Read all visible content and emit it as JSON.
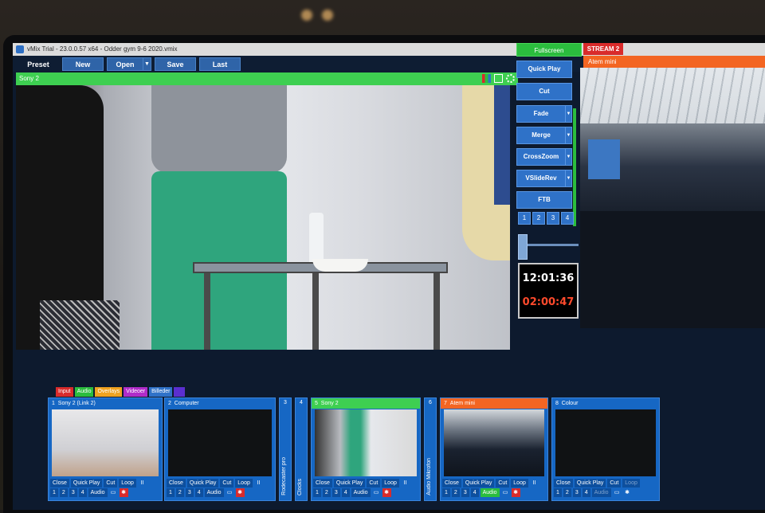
{
  "titlebar": {
    "text": "vMix Trial - 23.0.0.57 x64 - Odder gym 9-6 2020.vmix"
  },
  "toolbar": {
    "preset": "Preset",
    "new": "New",
    "open": "Open",
    "save": "Save",
    "last": "Last"
  },
  "preview": {
    "title": "Sony 2"
  },
  "fullscreen": "Fullscreen",
  "stream": "STREAM 2",
  "output": {
    "title": "Atem mini"
  },
  "transitions": {
    "quick_play": "Quick Play",
    "cut": "Cut",
    "fade": "Fade",
    "merge": "Merge",
    "crosszoom": "CrossZoom",
    "vslide": "VSlideRev",
    "ftb": "FTB",
    "nums": [
      "1",
      "2",
      "3",
      "4"
    ]
  },
  "clock": {
    "time": "12:01:36",
    "elapsed": "02:00:47"
  },
  "tabs": [
    {
      "label": "Input",
      "color": "#d92b2b"
    },
    {
      "label": "Audio",
      "color": "#2bbd3e"
    },
    {
      "label": "Overlays",
      "color": "#f0a320"
    },
    {
      "label": "Videoer",
      "color": "#b02cc9"
    },
    {
      "label": "Billeder",
      "color": "#2f72c8"
    },
    {
      "label": "",
      "color": "#5b2fd0"
    }
  ],
  "inputs": {
    "i1": {
      "num": "1",
      "name": "Sony 2 (Link 2)"
    },
    "i2": {
      "num": "2",
      "name": "Computer"
    },
    "i3": {
      "num": "3",
      "name": "Rodecaster pro"
    },
    "i4": {
      "num": "4",
      "name": "Clocks"
    },
    "i5": {
      "num": "5",
      "name": "Sony 2"
    },
    "i6": {
      "num": "6",
      "name": "Audio Mikrofon"
    },
    "i7": {
      "num": "7",
      "name": "Atem mini"
    },
    "i8": {
      "num": "8",
      "name": "Colour"
    }
  },
  "card_buttons": {
    "close": "Close",
    "quick_play": "Quick Play",
    "cut": "Cut",
    "loop": "Loop",
    "audio": "Audio",
    "pause": "II",
    "nums": [
      "1",
      "2",
      "3",
      "4"
    ]
  }
}
